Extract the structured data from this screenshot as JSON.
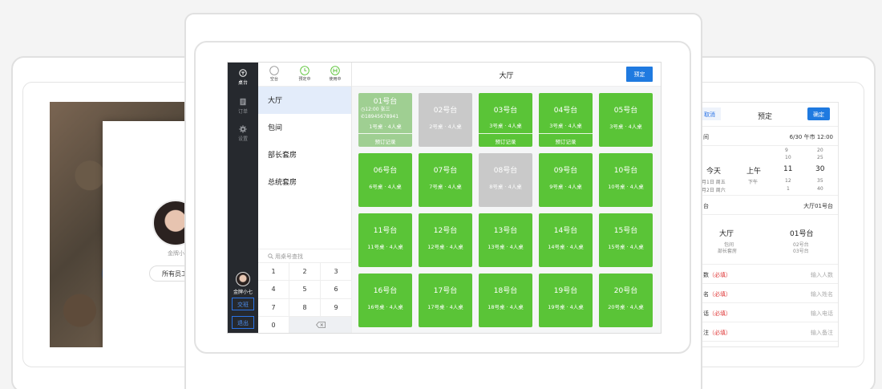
{
  "left_screen": {
    "user_name": "金牌小七",
    "staff_select": "所有员工"
  },
  "right_screen": {
    "cancel": "取消",
    "title": "预定",
    "ok": "确定",
    "time_label": "间",
    "time_value": "6/30 午市 12:00",
    "picker": {
      "day_prev1": "月1日 周五",
      "day_prev2": "月2日 周六",
      "day_selected": "今天",
      "period_selected": "上午",
      "period_next": "下午",
      "hour_up2": "9",
      "hour_up1": "10",
      "hour_selected": "11",
      "hour_down1": "12",
      "hour_down2": "1",
      "min_up2": "20",
      "min_up1": "25",
      "min_selected": "30",
      "min_down1": "35",
      "min_down2": "40"
    },
    "table_label": "台",
    "table_value": "大厅01号台",
    "venue": {
      "area_selected": "大厅",
      "area_next1": "包间",
      "area_next2": "部长套房",
      "table_selected": "01号台",
      "table_next1": "02号台",
      "table_next2": "03号台"
    },
    "fields": [
      {
        "label": "数",
        "required": "（必填）",
        "placeholder": "输入人数"
      },
      {
        "label": "名",
        "required": "（必填）",
        "placeholder": "输入姓名"
      },
      {
        "label": "话",
        "required": "（必填）",
        "placeholder": "输入电话"
      },
      {
        "label": "注",
        "required": "（必填）",
        "placeholder": "输入备注"
      }
    ]
  },
  "app": {
    "sidebar": {
      "items": [
        {
          "label": "桌台",
          "icon": "table-icon"
        },
        {
          "label": "订单",
          "icon": "order-icon"
        },
        {
          "label": "设置",
          "icon": "gear-icon"
        }
      ],
      "user_name": "金牌小七",
      "handover": "交班",
      "logout": "退出"
    },
    "status_legend": [
      {
        "label": "空台",
        "icon": "empty-circle-icon"
      },
      {
        "label": "预定中",
        "icon": "clock-icon"
      },
      {
        "label": "使用中",
        "icon": "in-use-icon"
      }
    ],
    "categories": [
      "大厅",
      "包间",
      "部长套房",
      "总统套房"
    ],
    "search_placeholder": "用桌号查找",
    "keypad": [
      "1",
      "2",
      "3",
      "4",
      "5",
      "6",
      "7",
      "8",
      "9",
      "0"
    ],
    "main_title": "大厅",
    "reserve_button": "预定",
    "record_label": "预订记录",
    "tables": [
      {
        "name": "01号台",
        "seats": "1号桌 · 4人桌",
        "status": "reserved",
        "time": "12:00 张三",
        "phone": "18945678941",
        "record": true
      },
      {
        "name": "02号台",
        "seats": "2号桌 · 4人桌",
        "status": "disabled",
        "record": false
      },
      {
        "name": "03号台",
        "seats": "3号桌 · 4人桌",
        "status": "empty",
        "record": true
      },
      {
        "name": "04号台",
        "seats": "3号桌 · 4人桌",
        "status": "empty",
        "record": true
      },
      {
        "name": "05号台",
        "seats": "3号桌 · 4人桌",
        "status": "empty",
        "record": false
      },
      {
        "name": "06号台",
        "seats": "6号桌 · 4人桌",
        "status": "empty",
        "record": false
      },
      {
        "name": "07号台",
        "seats": "7号桌 · 4人桌",
        "status": "empty",
        "record": false
      },
      {
        "name": "08号台",
        "seats": "8号桌 · 4人桌",
        "status": "disabled",
        "record": false
      },
      {
        "name": "09号台",
        "seats": "9号桌 · 4人桌",
        "status": "empty",
        "record": false
      },
      {
        "name": "10号台",
        "seats": "10号桌 · 4人桌",
        "status": "empty",
        "record": false
      },
      {
        "name": "11号台",
        "seats": "11号桌 · 4人桌",
        "status": "empty",
        "record": false
      },
      {
        "name": "12号台",
        "seats": "12号桌 · 4人桌",
        "status": "empty",
        "record": false
      },
      {
        "name": "13号台",
        "seats": "13号桌 · 4人桌",
        "status": "empty",
        "record": false
      },
      {
        "name": "14号台",
        "seats": "14号桌 · 4人桌",
        "status": "empty",
        "record": false
      },
      {
        "name": "15号台",
        "seats": "15号桌 · 4人桌",
        "status": "empty",
        "record": false
      },
      {
        "name": "16号台",
        "seats": "16号桌 · 4人桌",
        "status": "empty",
        "record": false
      },
      {
        "name": "17号台",
        "seats": "17号桌 · 4人桌",
        "status": "empty",
        "record": false
      },
      {
        "name": "18号台",
        "seats": "18号桌 · 4人桌",
        "status": "empty",
        "record": false
      },
      {
        "name": "19号台",
        "seats": "19号桌 · 4人桌",
        "status": "empty",
        "record": false
      },
      {
        "name": "20号台",
        "seats": "20号桌 · 4人桌",
        "status": "empty",
        "record": false
      }
    ],
    "colors": {
      "table_green": "#5ac437",
      "table_gray": "#c9c9c9",
      "table_reserved": "#9fcf92",
      "accent_blue": "#1f7ae0",
      "sidebar_dark": "#26292e"
    }
  }
}
